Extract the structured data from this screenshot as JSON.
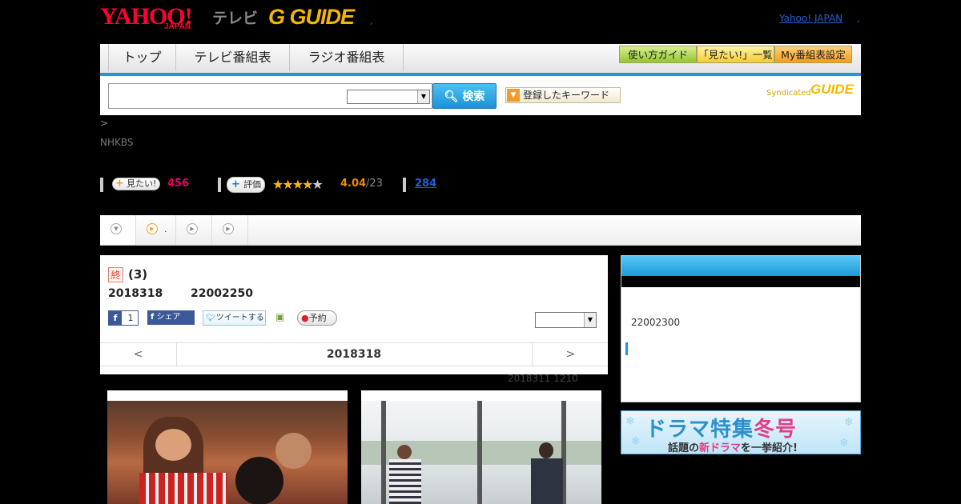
{
  "header": {
    "logo_yahoo": "YAHOO!",
    "logo_japan": "JAPAN",
    "logo_tv": "テレビ",
    "logo_gguide": "G GUIDE",
    "yahoo_japan_link": "Yahoo! JAPAN",
    "dot": ","
  },
  "nav": {
    "tabs": [
      "トップ",
      "テレビ番組表",
      "ラジオ番組表"
    ],
    "guide_buttons": [
      "使い方ガイド",
      "「見たい!」一覧",
      "My番組表設定"
    ]
  },
  "search": {
    "placeholder": "",
    "button_label": "検索",
    "keyword_button": "登録したキーワード",
    "syndicated": "Syndicated",
    "gguide": "GUIDE"
  },
  "breadcrumb": ">",
  "channel": "NHKBS",
  "stats": {
    "want_label": "見たい!",
    "want_count": "456",
    "rating_label": "評価",
    "rating_value": "4.04",
    "rating_count": "/23",
    "rating_stars": 4,
    "comment_count": "284"
  },
  "subtabs": [
    "",
    ".",
    "",
    ""
  ],
  "program": {
    "badge": "終",
    "title": "(3)",
    "date": "2018318",
    "time": "22002250",
    "fb_count": "1",
    "share_label": "シェア",
    "tweet_label": "ツイートする",
    "reserve_label": "予約",
    "nav_prev": "<",
    "nav_date": "2018318",
    "nav_next": ">",
    "updated": "2018311  1210"
  },
  "side": {
    "time": "22002300"
  },
  "banner": {
    "line1_a": "ドラマ特集",
    "line1_b": "冬号",
    "line2_a": "話題の",
    "line2_b": "新ドラマ",
    "line2_c": "を一挙紹介!"
  },
  "colors": {
    "accent": "#1a9ad8",
    "yahoo_red": "#ff0033",
    "gguide_yellow": "#f5b800",
    "want_pink": "#e60060"
  }
}
